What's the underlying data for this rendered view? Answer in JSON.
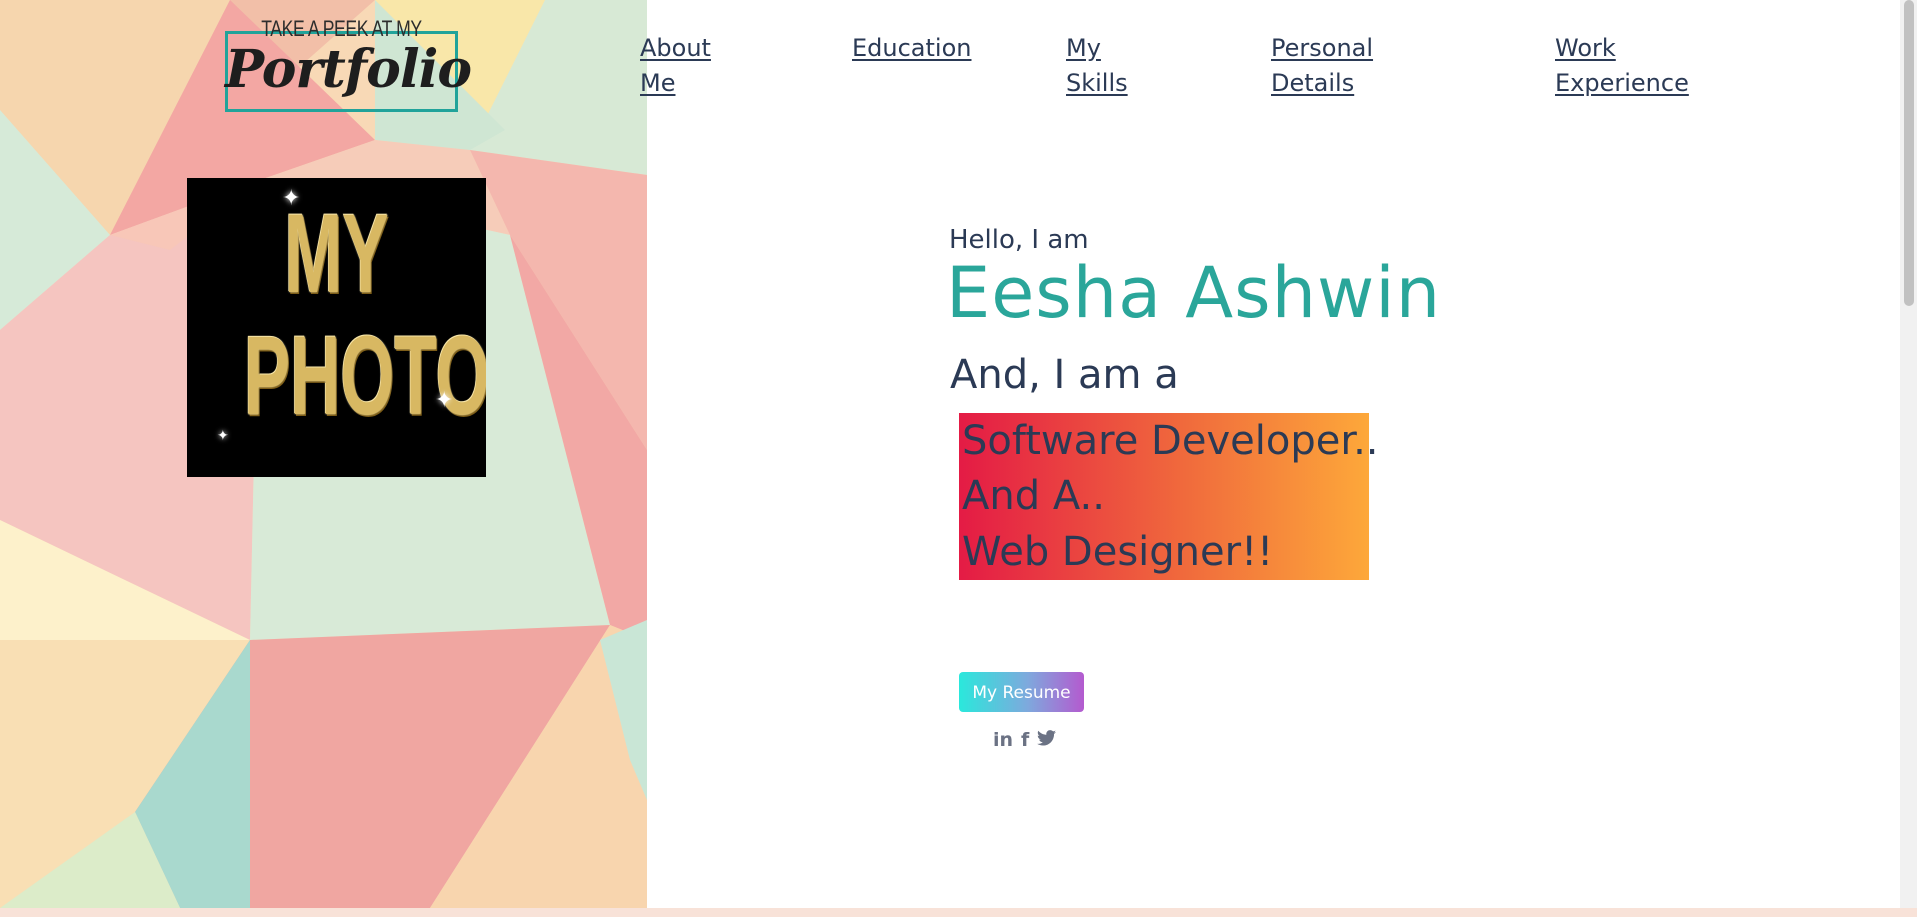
{
  "logo": {
    "top_text": "TAKE A PEEK AT MY",
    "main_text": "Portfolio"
  },
  "photo": {
    "line1": "MY",
    "line2": "PHOTO"
  },
  "nav": {
    "items": [
      {
        "line1": "About",
        "line2": "Me"
      },
      {
        "line1": "Education",
        "line2": ""
      },
      {
        "line1": "My",
        "line2": "Skills"
      },
      {
        "line1": "Personal",
        "line2": "Details"
      },
      {
        "line1": "Work",
        "line2": "Experience"
      }
    ]
  },
  "hero": {
    "greeting": "Hello, I am",
    "name": "Eesha Ashwin",
    "intro": "And, I am a",
    "roles": [
      "Software Developer..",
      "And A..",
      "Web Designer!!"
    ],
    "resume_label": "My Resume"
  },
  "socials": {
    "linkedin": "in",
    "facebook": "f",
    "twitter": "🐦"
  },
  "colors": {
    "accent": "#2aa69a",
    "text": "#2b3a55",
    "logo_border": "#21a39a",
    "roles_gradient": [
      "#e41b45",
      "#fda83a"
    ],
    "resume_gradient": [
      "#2ae8dc",
      "#b45acf"
    ]
  }
}
